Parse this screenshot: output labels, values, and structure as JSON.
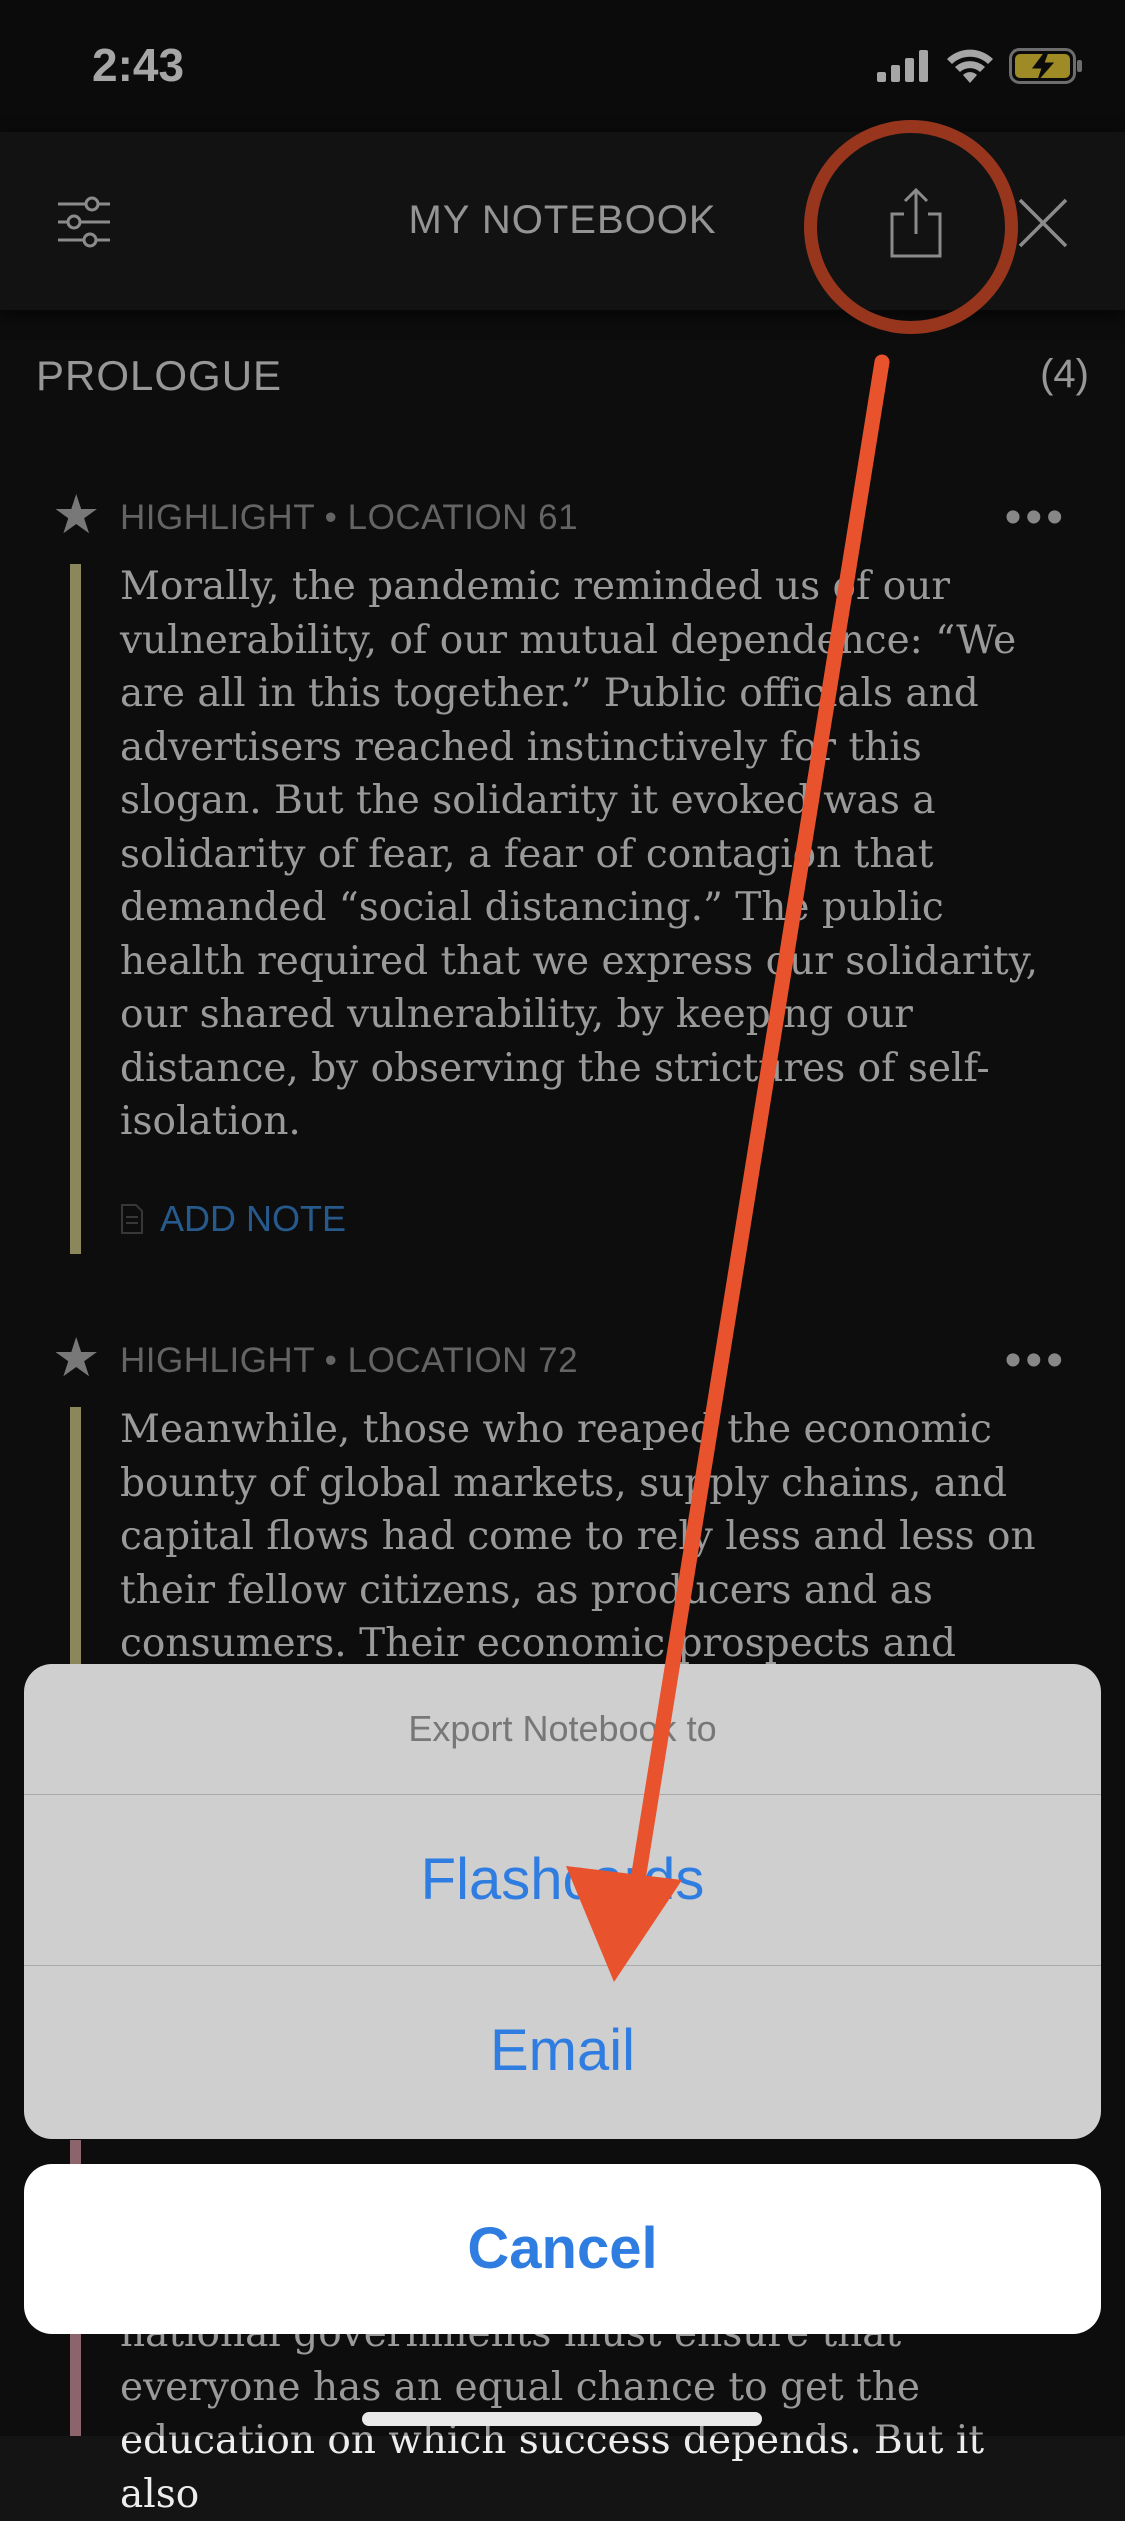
{
  "status_bar": {
    "time": "2:43"
  },
  "header": {
    "title": "MY NOTEBOOK"
  },
  "section": {
    "title": "PROLOGUE",
    "count": "(4)"
  },
  "highlights": [
    {
      "meta": "HIGHLIGHT • LOCATION 61",
      "text": "Morally, the pandemic reminded us of our\nvulnerability, of our mutual dependence: “We\nare all in this together.” Public officials and\nadvertisers reached instinctively for this\nslogan. But the solidarity it evoked was a\nsolidarity of fear, a fear of contagion that\ndemanded “social distancing.” The public\nhealth required that we express our solidarity,\nour shared vulnerability, by keeping our\ndistance, by observing the strictures of self-\nisolation.",
      "add_note": "ADD NOTE"
    },
    {
      "meta": "HIGHLIGHT • LOCATION 72",
      "text": "Meanwhile, those who reaped the economic\nbounty of global markets, supply chains, and\ncapital flows had come to rely less and less on\ntheir fellow citizens, as producers and as\nconsumers. Their economic prospects and"
    }
  ],
  "partial_text_bottom": "national governments must ensure that\neveryone has an equal chance to get the\neducation on which success depends. But it also",
  "action_sheet": {
    "title": "Export Notebook to",
    "options": [
      "Flashcards",
      "Email"
    ],
    "cancel": "Cancel"
  },
  "colors": {
    "highlight_bar": "#d8cf8a",
    "highlight_bar_pink": "#d79aa6",
    "link_blue": "#3b8ad8",
    "ios_blue": "#2f7de0",
    "annotation": "#e8522d"
  }
}
